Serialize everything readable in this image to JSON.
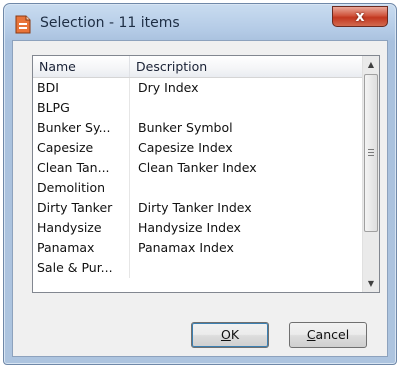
{
  "window": {
    "title": "Selection - 11 items",
    "close_label": "x"
  },
  "list": {
    "columns": [
      "Name",
      "Description"
    ],
    "rows": [
      {
        "name": "BDI",
        "description": "Dry Index"
      },
      {
        "name": "BLPG",
        "description": ""
      },
      {
        "name": "Bunker Sy...",
        "description": "Bunker Symbol"
      },
      {
        "name": "Capesize",
        "description": "Capesize Index"
      },
      {
        "name": "Clean Tan...",
        "description": "Clean Tanker Index"
      },
      {
        "name": "Demolition",
        "description": ""
      },
      {
        "name": "Dirty Tanker",
        "description": "Dirty Tanker Index"
      },
      {
        "name": "Handysize",
        "description": "Handysize Index"
      },
      {
        "name": "Panamax",
        "description": "Panamax Index"
      },
      {
        "name": "Sale & Pur...",
        "description": ""
      }
    ]
  },
  "buttons": {
    "ok": {
      "mnemonic": "O",
      "rest": "K"
    },
    "cancel": {
      "mnemonic": "C",
      "rest": "ancel"
    }
  },
  "colors": {
    "close_button": "#c2371f",
    "title_bar": "#b4cbe6",
    "client_background": "#f0f0f0"
  }
}
